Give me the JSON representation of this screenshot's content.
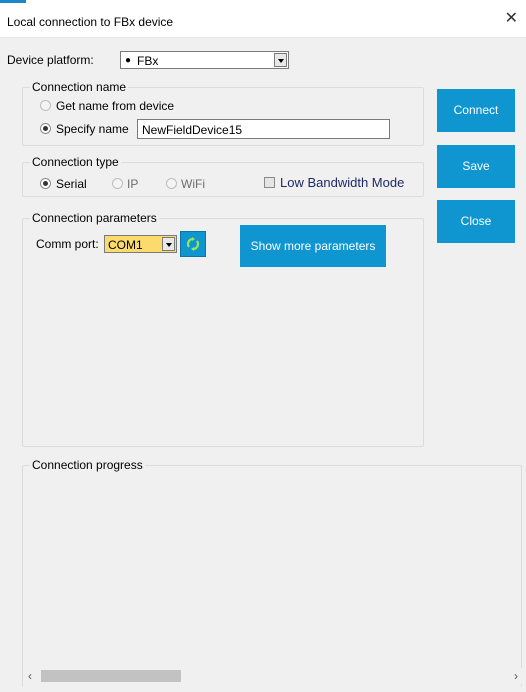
{
  "window": {
    "title": "Local connection to FBx device"
  },
  "platform": {
    "label": "Device platform:",
    "value": "FBx"
  },
  "connection_name": {
    "legend": "Connection name",
    "option_from_device": "Get name from device",
    "option_specify": "Specify name",
    "name_value": "NewFieldDevice15"
  },
  "connection_type": {
    "legend": "Connection type",
    "serial": "Serial",
    "ip": "IP",
    "wifi": "WiFi",
    "low_bandwidth": "Low Bandwidth Mode"
  },
  "connection_params": {
    "legend": "Connection parameters",
    "comm_port_label": "Comm port:",
    "comm_port_value": "COM1",
    "show_more": "Show more parameters"
  },
  "buttons": {
    "connect": "Connect",
    "save": "Save",
    "close": "Close"
  },
  "progress": {
    "legend": "Connection progress"
  },
  "colors": {
    "accent": "#0f95cf",
    "highlight": "#fbdb6b"
  }
}
